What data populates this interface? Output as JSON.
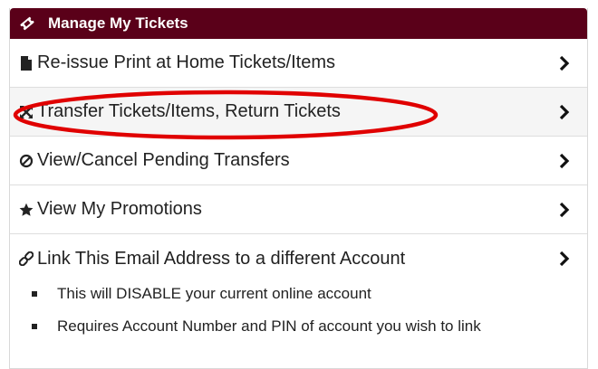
{
  "header": {
    "title": "Manage My Tickets",
    "icon": "ticket-icon"
  },
  "rows": [
    {
      "label": "Re-issue Print at Home Tickets/Items",
      "icon": "document-icon"
    },
    {
      "label": "Transfer Tickets/Items, Return Tickets",
      "icon": "transfer-arrows-icon"
    },
    {
      "label": "View/Cancel Pending Transfers",
      "icon": "ban-icon"
    },
    {
      "label": "View My Promotions",
      "icon": "star-icon"
    },
    {
      "label": "Link This Email Address to a different Account",
      "icon": "link-icon"
    }
  ],
  "notes": [
    "This will DISABLE your current online account",
    "Requires Account Number and PIN of account you wish to link"
  ],
  "colors": {
    "header_bg": "#5a0019",
    "highlight": "#e00000"
  }
}
